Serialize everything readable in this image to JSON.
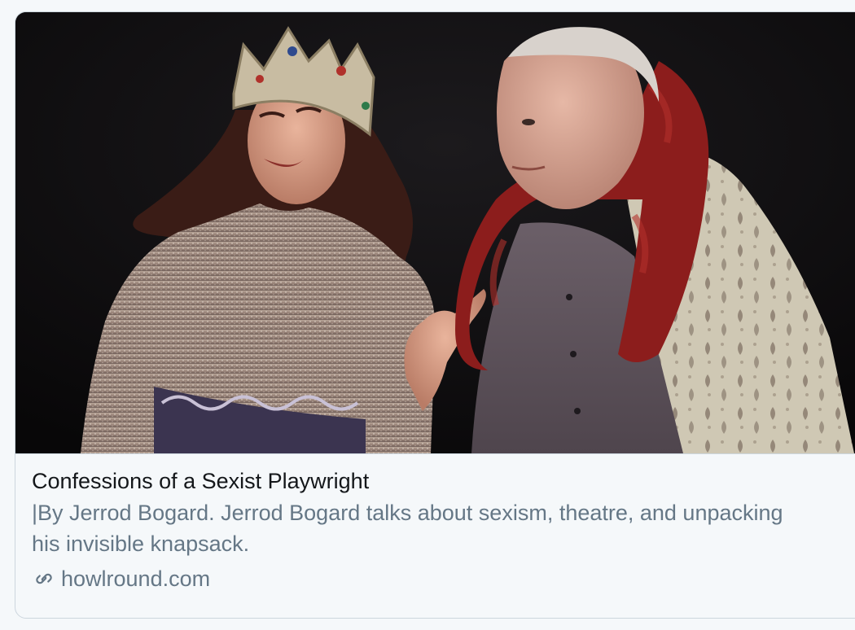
{
  "card": {
    "title": "Confessions of a Sexist Playwright",
    "description": "|By Jerrod Bogard. Jerrod Bogard talks about sexism, theatre, and unpacking his invisible knapsack.",
    "domain": "howlround.com",
    "link_icon": "link-icon",
    "image": "photo of two actors on stage: a woman wearing a jeweled crown and sparkling gown, and an older man wearing a red scarf and brocade robe"
  },
  "colors": {
    "title": "#14171a",
    "secondary": "#657786",
    "border": "#ccd6dd",
    "background": "#f5f8fa"
  }
}
